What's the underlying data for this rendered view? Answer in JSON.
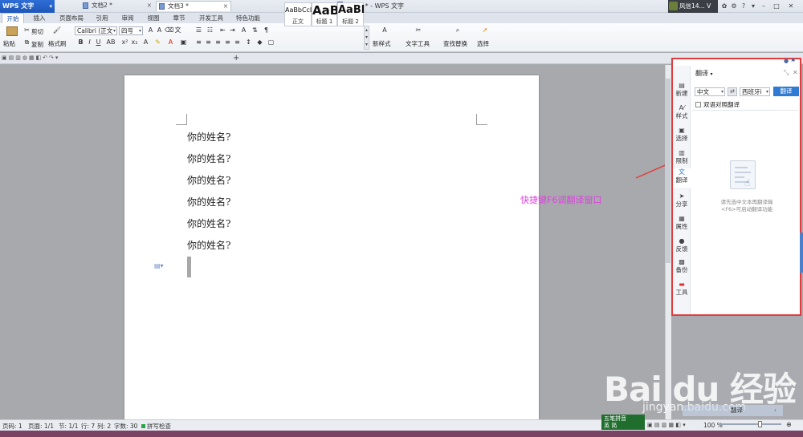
{
  "app": {
    "name": "WPS 文字",
    "doc_title": "文档3 * - WPS 文字",
    "user": "风信14...",
    "user_caret": "V"
  },
  "menu_tabs": [
    "开始",
    "插入",
    "页面布局",
    "引用",
    "审阅",
    "视图",
    "章节",
    "开发工具",
    "特色功能"
  ],
  "ribbon": {
    "paste": "粘贴",
    "cut": "剪切",
    "copy": "复制",
    "format_painter": "格式刷",
    "font": "Calibri (正文",
    "size": "四号",
    "styles": [
      {
        "preview": "AaBbCcI",
        "label": "正文"
      },
      {
        "preview": "AaB",
        "label": "标题 1"
      },
      {
        "preview": "AaBl",
        "label": "标题 2"
      }
    ],
    "new_style": "新样式",
    "text_tools": "文字工具",
    "find_replace": "查找替换",
    "select": "选择"
  },
  "doc_tabs": [
    {
      "label": "文档2 *"
    },
    {
      "label": "文档3 *"
    }
  ],
  "document": {
    "lines": [
      "你的姓名?",
      "你的姓名?",
      "你的姓名?",
      "你的姓名?",
      "你的姓名?",
      "你的姓名?"
    ]
  },
  "annotation": "快捷键F6调翻译窗口",
  "side_panel": {
    "items": [
      {
        "label": "新建",
        "icon": "new-doc-icon",
        "glyph": "▤"
      },
      {
        "label": "样式",
        "icon": "style-icon",
        "glyph": "A⁄"
      },
      {
        "label": "选择",
        "icon": "select-icon",
        "glyph": "▣"
      },
      {
        "label": "限制",
        "icon": "restrict-icon",
        "glyph": "▥"
      },
      {
        "label": "翻译",
        "icon": "translate-icon",
        "glyph": "文"
      },
      {
        "label": "分享",
        "icon": "share-icon",
        "glyph": "➤"
      },
      {
        "label": "属性",
        "icon": "property-icon",
        "glyph": "▦"
      },
      {
        "label": "反馈",
        "icon": "feedback-icon",
        "glyph": "●"
      },
      {
        "label": "备份",
        "icon": "backup-icon",
        "glyph": "▩"
      },
      {
        "label": "工具",
        "icon": "toolbox-icon",
        "glyph": "▬"
      }
    ],
    "translate_title": "翻译",
    "source_lang": "中文",
    "target_lang": "西班牙i",
    "translate_button": "翻译",
    "bilingual_label": "双语对照翻译",
    "hint_line1": "请先选中文本再翻译输",
    "hint_line2": "<F6>可启动翻译功能"
  },
  "status": {
    "page_no": "页码: 1",
    "pages": "页面: 1/1",
    "section": "节: 1/1",
    "row": "行: 7",
    "col": "列: 2",
    "chars": "字数: 30",
    "spell": "拼写检查",
    "ime_line1": "五笔拼音",
    "ime_line2": "英 简",
    "zoom": "100 %"
  },
  "watermark": {
    "logo": "Bai du 经验",
    "url": "jingyan.baidu.com",
    "banner": "翻译"
  },
  "colors": {
    "accent": "#2f7ad3",
    "annotation": "#e040e0",
    "highlight_border": "#e23b3b"
  }
}
